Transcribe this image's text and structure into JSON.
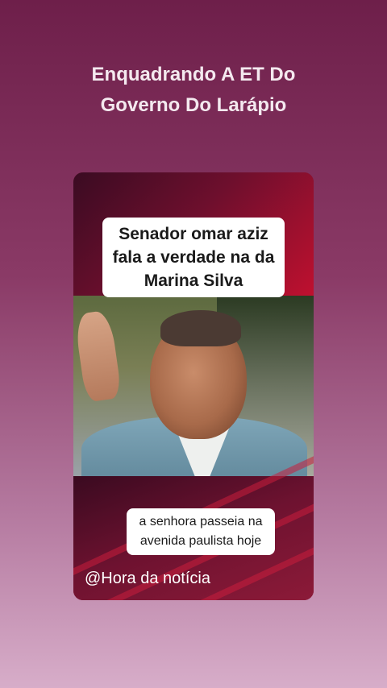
{
  "post": {
    "headline_line1": "Enquadrando A ET Do",
    "headline_line2": "Governo Do Larápio"
  },
  "video": {
    "caption_top_line1": "Senador omar aziz",
    "caption_top_line2": "fala a verdade na da",
    "caption_top_line3": "Marina Silva",
    "caption_bottom_line1": "a senhora passeia na",
    "caption_bottom_line2": "avenida paulista hoje",
    "watermark": "@Hora da notícia"
  },
  "colors": {
    "background_top": "#6e1f4a",
    "background_bottom": "#d7adc9",
    "card_red": "#c0102f",
    "caption_bg": "#ffffff"
  }
}
